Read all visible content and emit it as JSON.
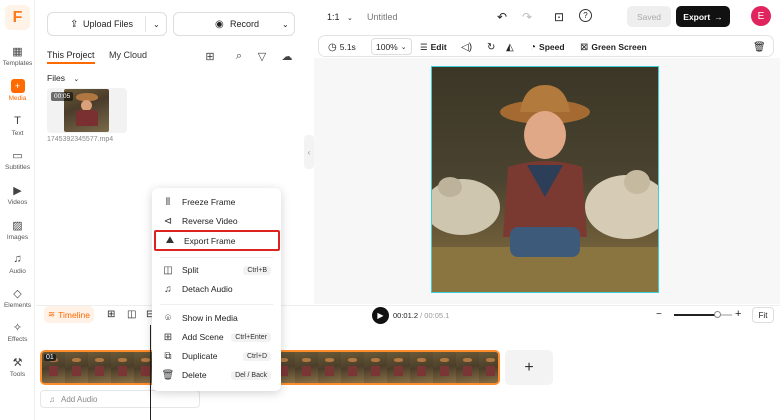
{
  "sidebar": {
    "logo": "F",
    "items": [
      {
        "label": "Templates"
      },
      {
        "label": "Media"
      },
      {
        "label": "Text"
      },
      {
        "label": "Subtitles"
      },
      {
        "label": "Videos"
      },
      {
        "label": "Images"
      },
      {
        "label": "Audio"
      },
      {
        "label": "Elements"
      },
      {
        "label": "Effects"
      },
      {
        "label": "Tools"
      }
    ]
  },
  "panel": {
    "upload_label": "Upload Files",
    "record_label": "Record",
    "tabs": [
      {
        "label": "This Project"
      },
      {
        "label": "My Cloud"
      }
    ],
    "files_label": "Files",
    "file": {
      "duration": "00:05",
      "name": "1745392345577.mp4"
    }
  },
  "topbar": {
    "ratio": "1:1",
    "title": "Untitled",
    "saved_label": "Saved",
    "export_label": "Export",
    "avatar": "E"
  },
  "toolbar": {
    "duration": "5.1s",
    "zoom": "100%",
    "edit_label": "Edit",
    "speed_label": "Speed",
    "green_screen_label": "Green Screen"
  },
  "timeline": {
    "tab_label": "Timeline",
    "current_time": "00:01.2",
    "total_time": "00:05.1",
    "fit_label": "Fit",
    "zoom_level": 0.75,
    "clip_number": "01",
    "add_scene_symbol": "+",
    "add_audio_label": "Add Audio"
  },
  "context_menu": {
    "items": [
      {
        "label": "Freeze Frame",
        "icon": "freeze-icon",
        "shortcut": ""
      },
      {
        "label": "Reverse Video",
        "icon": "reverse-icon",
        "shortcut": ""
      },
      {
        "label": "Export Frame",
        "icon": "image-icon",
        "shortcut": "",
        "highlighted": true
      },
      {
        "label": "Split",
        "icon": "split-icon",
        "shortcut": "Ctrl+B"
      },
      {
        "label": "Detach Audio",
        "icon": "music-icon",
        "shortcut": ""
      },
      {
        "label": "Show in Media",
        "icon": "location-icon",
        "shortcut": ""
      },
      {
        "label": "Add Scene",
        "icon": "add-icon",
        "shortcut": "Ctrl+Enter"
      },
      {
        "label": "Duplicate",
        "icon": "copy-icon",
        "shortcut": "Ctrl+D"
      },
      {
        "label": "Delete",
        "icon": "trash-icon",
        "shortcut": "Del / Back"
      }
    ]
  },
  "colors": {
    "accent": "#ff6a00",
    "highlight": "#dd2222",
    "frame_border": "#3ccfd6",
    "export_bg": "#111111",
    "avatar_bg": "#e0245e"
  }
}
